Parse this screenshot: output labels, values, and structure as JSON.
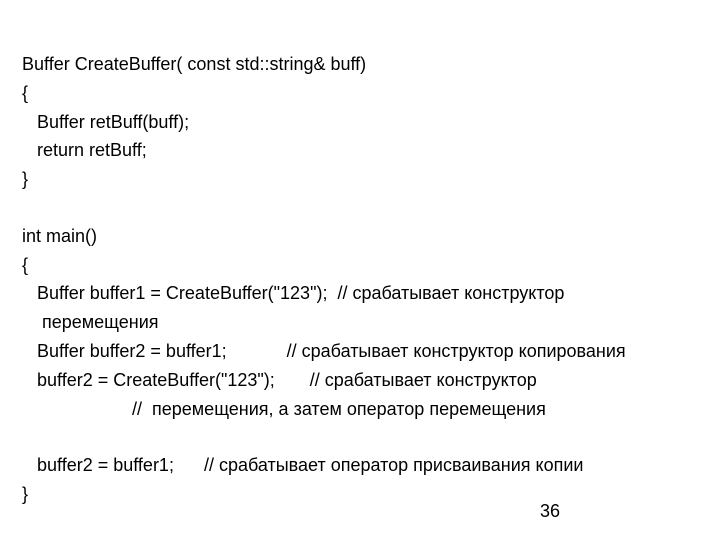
{
  "code": {
    "lines": [
      "Buffer CreateBuffer( const std::string& buff)",
      "{",
      "   Buffer retBuff(buff);",
      "   return retBuff;",
      "}",
      "",
      "int main()",
      "{",
      "   Buffer buffer1 = CreateBuffer(\"123\");  // срабатывает конструктор",
      "    перемещения",
      "   Buffer buffer2 = buffer1;            // срабатывает конструктор копирования",
      "   buffer2 = CreateBuffer(\"123\");       // срабатывает конструктор ",
      "                      //  перемещения, а затем оператор перемещения",
      "",
      "   buffer2 = buffer1;      // срабатывает оператор присваивания копии",
      "}"
    ]
  },
  "page_number": "36"
}
